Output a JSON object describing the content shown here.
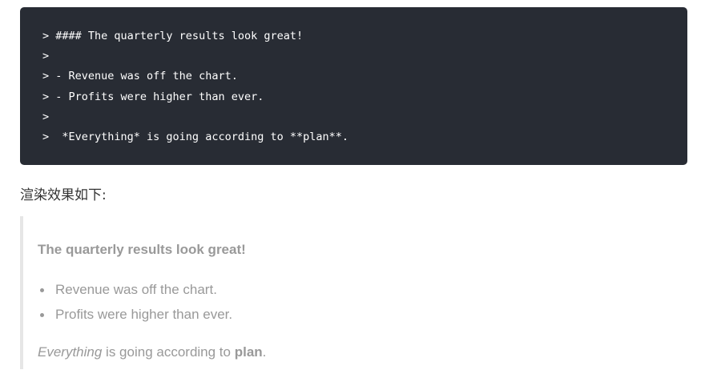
{
  "code_block": {
    "lines": [
      "> #### The quarterly results look great!",
      ">",
      "> - Revenue was off the chart.",
      "> - Profits were higher than ever.",
      ">",
      ">  *Everything* is going according to **plan**."
    ]
  },
  "caption": "渲染效果如下:",
  "rendered_quote": {
    "heading": "The quarterly results look great!",
    "list_items": [
      "Revenue was off the chart.",
      "Profits were higher than ever."
    ],
    "paragraph": {
      "italic_word": "Everything",
      "middle_text": " is going according to ",
      "bold_word": "plan",
      "end_text": "."
    }
  },
  "colors": {
    "code_background": "#282c34",
    "code_text": "#ffffff",
    "quote_text": "#999999",
    "quote_border": "#e6e6e6"
  }
}
